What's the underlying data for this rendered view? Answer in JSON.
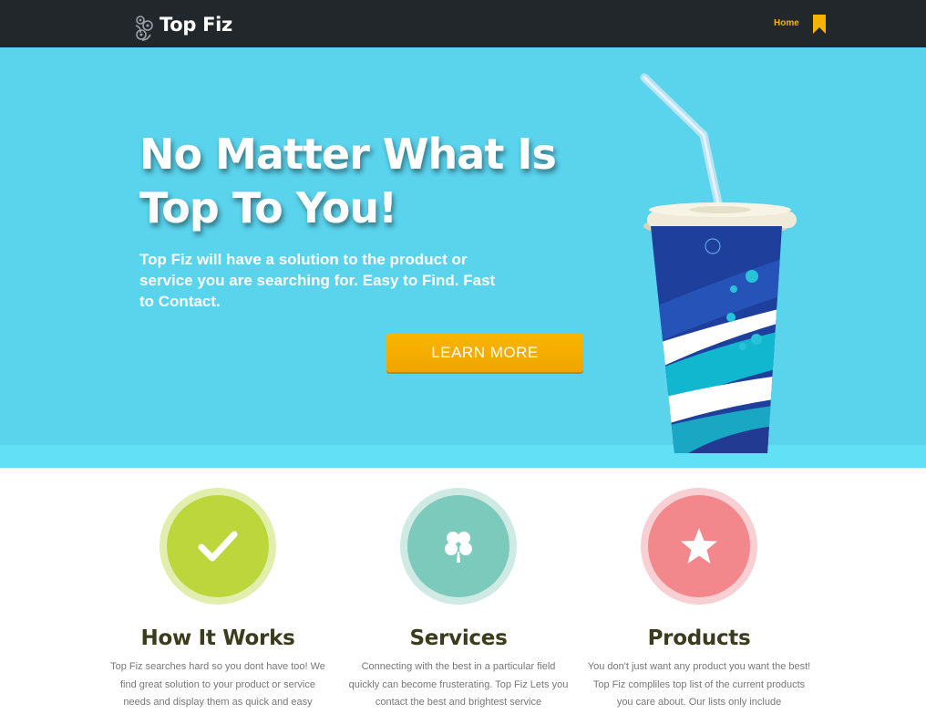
{
  "header": {
    "brand": "Top Fiz",
    "nav_home": "Home",
    "colors": {
      "bar": "#22272c",
      "nav_active": "#f5b400"
    }
  },
  "hero": {
    "title_line1": "No Matter What Is",
    "title_line2": "Top To You!",
    "subtitle": "Top Fiz will have a solution to the product or service you are searching for.  Easy to Find. Fast to Contact.",
    "cta_label": "LEARN MORE",
    "colors": {
      "background": "#5ad3ed",
      "cta": "#f5ac00"
    }
  },
  "features": [
    {
      "title": "How It Works",
      "icon": "checkmark-icon",
      "color": "#bdd63b",
      "text": "Top Fiz searches hard so you dont have too! We find great solution to your product or service needs and display them as quick and easy"
    },
    {
      "title": "Services",
      "icon": "clover-icon",
      "color": "#7ccabb",
      "text": "Connecting with the best in a particular field quickly can become frusterating.  Top Fiz Lets you contact the best and brightest service"
    },
    {
      "title": "Products",
      "icon": "star-icon",
      "color": "#f2878c",
      "text": "You don't just want any product you want the best!  Top Fiz compliles top list of the current products you care about.  Our lists only include"
    }
  ]
}
